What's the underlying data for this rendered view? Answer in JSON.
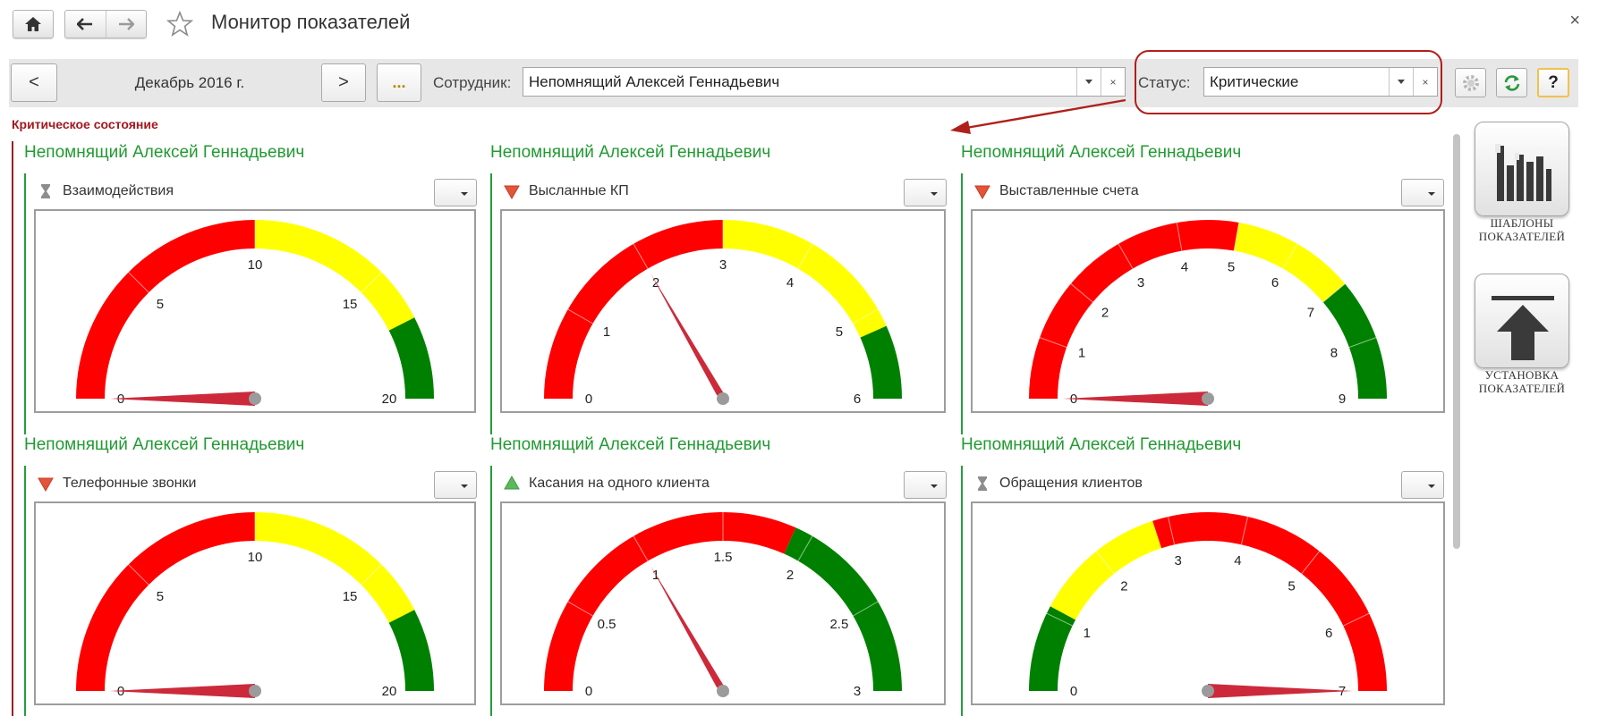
{
  "window": {
    "title": "Монитор показателей",
    "close_glyph": "×"
  },
  "toolbar": {
    "prev_label": "<",
    "period": "Декабрь 2016 г.",
    "next_label": ">",
    "more_label": "...",
    "employee_label": "Сотрудник:",
    "employee_value": "Непомнящий Алексей Геннадьевич",
    "status_label": "Статус:",
    "status_value": "Критические",
    "clear_glyph": "×",
    "help_label": "?"
  },
  "section_title": "Критическое состояние",
  "panels": [
    {
      "person": "Непомнящий Алексей Геннадьевич",
      "indicator": "Взаимодействия",
      "trend_icon": "hourglass-icon",
      "gauge": {
        "min": 0,
        "max": 20,
        "value": 0,
        "ticks": [
          "0",
          "5",
          "10",
          "15",
          "20"
        ],
        "bands": [
          {
            "from": 0,
            "to": 10,
            "color": "red"
          },
          {
            "from": 10,
            "to": 17,
            "color": "yellow"
          },
          {
            "from": 17,
            "to": 20,
            "color": "green"
          }
        ]
      }
    },
    {
      "person": "Непомнящий Алексей Геннадьевич",
      "indicator": "Высланные КП",
      "trend_icon": "down-triangle-icon",
      "gauge": {
        "min": 0,
        "max": 6,
        "value": 2,
        "ticks": [
          "0",
          "1",
          "2",
          "3",
          "4",
          "5",
          "6"
        ],
        "bands": [
          {
            "from": 0,
            "to": 3,
            "color": "red"
          },
          {
            "from": 3,
            "to": 5.2,
            "color": "yellow"
          },
          {
            "from": 5.2,
            "to": 6,
            "color": "green"
          }
        ]
      }
    },
    {
      "person": "Непомнящий Алексей Геннадьевич",
      "indicator": "Выставленные счета",
      "trend_icon": "down-triangle-icon",
      "gauge": {
        "min": 0,
        "max": 9,
        "value": 0,
        "ticks": [
          "0",
          "1",
          "2",
          "3",
          "4",
          "5",
          "6",
          "7",
          "8",
          "9"
        ],
        "bands": [
          {
            "from": 0,
            "to": 5,
            "color": "red"
          },
          {
            "from": 5,
            "to": 7,
            "color": "yellow"
          },
          {
            "from": 7,
            "to": 9,
            "color": "green"
          }
        ]
      }
    },
    {
      "person": "Непомнящий Алексей Геннадьевич",
      "indicator": "Телефонные звонки",
      "trend_icon": "down-triangle-icon",
      "gauge": {
        "min": 0,
        "max": 20,
        "value": 0,
        "ticks": [
          "0",
          "5",
          "10",
          "15",
          "20"
        ],
        "bands": [
          {
            "from": 0,
            "to": 10,
            "color": "red"
          },
          {
            "from": 10,
            "to": 17,
            "color": "yellow"
          },
          {
            "from": 17,
            "to": 20,
            "color": "green"
          }
        ]
      }
    },
    {
      "person": "Непомнящий Алексей Геннадьевич",
      "indicator": "Касания на одного клиента",
      "trend_icon": "up-triangle-icon",
      "gauge": {
        "min": 0,
        "max": 3,
        "value": 1,
        "ticks": [
          "0",
          "0.5",
          "1",
          "1.5",
          "2",
          "2.5",
          "3"
        ],
        "bands": [
          {
            "from": 0,
            "to": 1.9,
            "color": "red"
          },
          {
            "from": 1.9,
            "to": 3,
            "color": "green"
          }
        ]
      }
    },
    {
      "person": "Непомнящий Алексей Геннадьевич",
      "indicator": "Обращения клиентов",
      "trend_icon": "hourglass-icon",
      "gauge": {
        "min": 0,
        "max": 7,
        "value": 7,
        "ticks": [
          "0",
          "1",
          "2",
          "3",
          "4",
          "5",
          "6",
          "7"
        ],
        "bands": [
          {
            "from": 0,
            "to": 1.1,
            "color": "green"
          },
          {
            "from": 1.1,
            "to": 2.8,
            "color": "yellow"
          },
          {
            "from": 2.8,
            "to": 7,
            "color": "red"
          }
        ]
      }
    }
  ],
  "sidebar": {
    "templates_label": "ШАБЛОНЫ\nПОКАЗАТЕЛЕЙ",
    "install_label": "УСТАНОВКА\nПОКАЗАТЕЛЕЙ"
  },
  "colors": {
    "red": "#ff0000",
    "yellow": "#ffff00",
    "green": "#008000",
    "needle": "#cc2a3a",
    "person_text": "#219a32",
    "critical_text": "#a2191f"
  }
}
